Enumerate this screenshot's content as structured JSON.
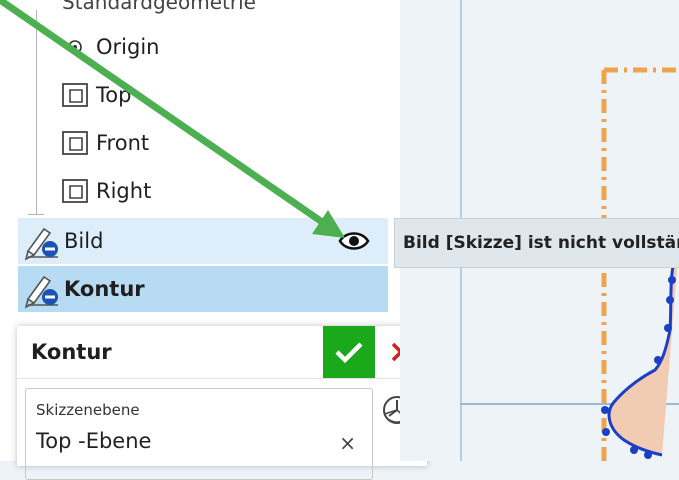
{
  "tree": {
    "header_cut": "Standardgeometrie",
    "items": [
      {
        "label": "Origin"
      },
      {
        "label": "Top"
      },
      {
        "label": "Front"
      },
      {
        "label": "Right"
      }
    ]
  },
  "features": {
    "bild": {
      "label": "Bild"
    },
    "kontur": {
      "label": "Kontur"
    }
  },
  "tooltip": {
    "text": "Bild [Skizze] ist nicht vollständig"
  },
  "dialog": {
    "title": "Kontur",
    "field_label": "Skizzenebene",
    "field_value": "Top -Ebene",
    "clear_symbol": "×"
  },
  "colors": {
    "arrow": "#4caf50",
    "selected_row": "#b7dbf3",
    "hover_row": "#ddeefa",
    "ok": "#1ba91b",
    "cancel": "#d32020",
    "sketch_line": "#1c3fc4",
    "sketch_frame": "#f0a34d"
  }
}
